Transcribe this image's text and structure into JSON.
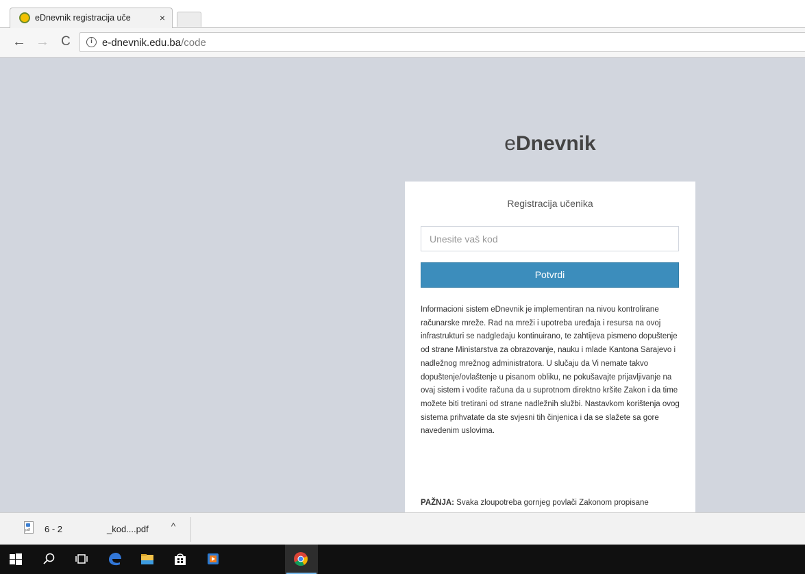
{
  "browser": {
    "tab_title": "eDnevnik registracija uče",
    "tab_close": "×",
    "url_host": "e-dnevnik.edu.ba",
    "url_path": "/code",
    "nav": {
      "back": "←",
      "forward": "→",
      "reload": "C"
    }
  },
  "page": {
    "brand_prefix": "e",
    "brand_main": "Dnevnik",
    "form_title": "Registracija učenika",
    "code_placeholder": "Unesite vaš kod",
    "submit_label": "Potvrdi",
    "notice": "Informacioni sistem eDnevnik je implementiran na nivou kontrolirane računarske mreže. Rad na mreži i upotreba uređaja i resursa na ovoj infrastrukturi se nadgledaju kontinuirano, te zahtijeva pismeno dopuštenje od strane Ministarstva za obrazovanje, nauku i mlade Kantona Sarajevo i nadležnog mrežnog administratora. U slučaju da Vi nemate takvo dopuštenje/ovlaštenje u pisanom obliku, ne pokušavajte prijavljivanje na ovaj sistem i vodite računa da u suprotnom direktno kršite Zakon i da time možete biti tretirani od strane nadležnih službi. Nastavkom korištenja ovog sistema prihvatate da ste svjesni tih činjenica i da se slažete sa gore navedenim uslovima.",
    "warning_label": "PAŽNJA:",
    "warning_text": " Svaka zloupotreba gornjeg povlači Zakonom propisane"
  },
  "downloads": {
    "file_name_part1": "6 - 2",
    "file_name_part2": "_kod....pdf",
    "chevron": "^"
  },
  "taskbar": {
    "items": [
      "windows-start",
      "search",
      "task-view",
      "edge",
      "file-explorer",
      "store",
      "media-player",
      "chrome"
    ]
  },
  "colors": {
    "page_background": "#d2d6de",
    "primary_button": "#3c8dbc",
    "taskbar": "#101010"
  }
}
